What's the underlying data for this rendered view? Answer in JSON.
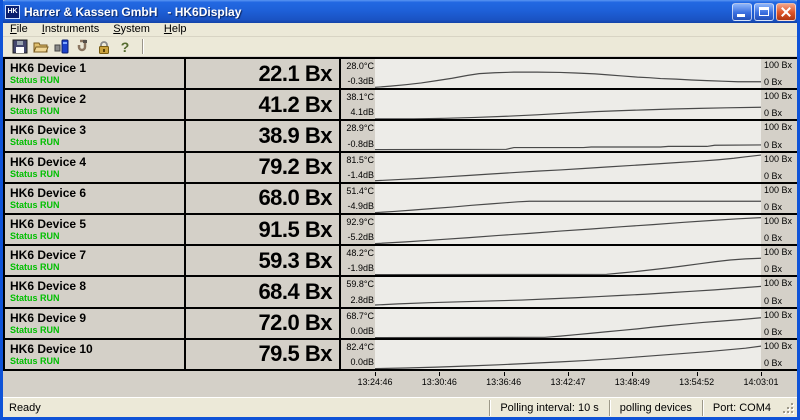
{
  "window": {
    "title": "Harrer & Kassen GmbH   - HK6Display",
    "icon_text": "HK"
  },
  "menu": {
    "items": [
      "File",
      "Instruments",
      "System",
      "Help"
    ]
  },
  "toolbar": {
    "icons": [
      "save-icon",
      "open-folder-icon",
      "instrument-icon",
      "probe-icon",
      "lock-icon",
      "help-icon"
    ]
  },
  "chart_axis": {
    "top": "100 Bx",
    "bottom": "0 Bx"
  },
  "devices": [
    {
      "name": "HK6 Device 1",
      "status": "Status RUN",
      "value": "22.1 Bx",
      "temp": "28.0°C",
      "db": "-0.3dB"
    },
    {
      "name": "HK6 Device 2",
      "status": "Status RUN",
      "value": "41.2 Bx",
      "temp": "38.1°C",
      "db": "4.1dB"
    },
    {
      "name": "HK6 Device 3",
      "status": "Status RUN",
      "value": "38.9 Bx",
      "temp": "28.9°C",
      "db": "-0.8dB"
    },
    {
      "name": "HK6 Device 4",
      "status": "Status RUN",
      "value": "79.2 Bx",
      "temp": "81.5°C",
      "db": "-1.4dB"
    },
    {
      "name": "HK6 Device 6",
      "status": "Status RUN",
      "value": "68.0 Bx",
      "temp": "51.4°C",
      "db": "-4.9dB"
    },
    {
      "name": "HK6 Device 5",
      "status": "Status RUN",
      "value": "91.5 Bx",
      "temp": "92.9°C",
      "db": "-5.2dB"
    },
    {
      "name": "HK6 Device 7",
      "status": "Status RUN",
      "value": "59.3 Bx",
      "temp": "48.2°C",
      "db": "-1.9dB"
    },
    {
      "name": "HK6 Device 8",
      "status": "Status RUN",
      "value": "68.4 Bx",
      "temp": "59.8°C",
      "db": "2.8dB"
    },
    {
      "name": "HK6 Device 9",
      "status": "Status RUN",
      "value": "72.0 Bx",
      "temp": "68.7°C",
      "db": "0.0dB"
    },
    {
      "name": "HK6 Device 10",
      "status": "Status RUN",
      "value": "79.5 Bx",
      "temp": "82.4°C",
      "db": "0.0dB"
    }
  ],
  "chart_data": {
    "type": "line",
    "ylabel": "Bx",
    "ylim": [
      0,
      100
    ],
    "x_range_note": "x is percent of trend window width",
    "x_time_labels": [
      "13:24:46",
      "13:30:46",
      "13:36:46",
      "13:42:47",
      "13:48:49",
      "13:54:52",
      "14:03:01"
    ],
    "series": [
      {
        "name": "HK6 Device 1",
        "current_bx": 22.1,
        "points": [
          [
            0,
            3
          ],
          [
            4,
            7
          ],
          [
            8,
            12
          ],
          [
            12,
            18
          ],
          [
            16,
            26
          ],
          [
            20,
            34
          ],
          [
            24,
            44
          ],
          [
            27,
            50
          ],
          [
            31,
            53
          ],
          [
            36,
            55
          ],
          [
            42,
            55
          ],
          [
            48,
            54
          ],
          [
            52,
            52
          ],
          [
            57,
            49
          ],
          [
            60,
            46
          ],
          [
            64,
            42
          ],
          [
            68,
            38
          ],
          [
            71,
            36
          ],
          [
            74,
            33
          ],
          [
            78,
            31
          ],
          [
            82,
            28
          ],
          [
            86,
            26
          ],
          [
            90,
            24
          ],
          [
            94,
            22
          ],
          [
            100,
            22
          ]
        ]
      },
      {
        "name": "HK6 Device 2",
        "current_bx": 41.2,
        "points": [
          [
            0,
            1
          ],
          [
            10,
            1
          ],
          [
            18,
            3
          ],
          [
            26,
            6
          ],
          [
            34,
            10
          ],
          [
            42,
            15
          ],
          [
            50,
            21
          ],
          [
            57,
            26
          ],
          [
            63,
            29
          ],
          [
            70,
            32
          ],
          [
            77,
            35
          ],
          [
            84,
            37
          ],
          [
            91,
            39
          ],
          [
            100,
            41
          ]
        ]
      },
      {
        "name": "HK6 Device 3",
        "current_bx": 38.9,
        "points": [
          [
            0,
            2
          ],
          [
            34,
            3
          ],
          [
            36,
            9
          ],
          [
            54,
            9
          ],
          [
            56,
            11
          ],
          [
            74,
            11
          ],
          [
            76,
            13
          ],
          [
            86,
            13
          ],
          [
            88,
            17
          ],
          [
            100,
            18
          ]
        ]
      },
      {
        "name": "HK6 Device 4",
        "current_bx": 79.2,
        "points": [
          [
            0,
            5
          ],
          [
            6,
            9
          ],
          [
            12,
            13
          ],
          [
            18,
            18
          ],
          [
            24,
            23
          ],
          [
            30,
            28
          ],
          [
            36,
            33
          ],
          [
            42,
            38
          ],
          [
            48,
            42
          ],
          [
            54,
            47
          ],
          [
            60,
            52
          ],
          [
            66,
            57
          ],
          [
            72,
            62
          ],
          [
            78,
            67
          ],
          [
            84,
            72
          ],
          [
            89,
            77
          ],
          [
            93,
            82
          ],
          [
            96,
            87
          ],
          [
            100,
            93
          ]
        ]
      },
      {
        "name": "HK6 Device 6",
        "current_bx": 68.0,
        "points": [
          [
            0,
            2
          ],
          [
            5,
            6
          ],
          [
            10,
            11
          ],
          [
            15,
            16
          ],
          [
            20,
            21
          ],
          [
            25,
            27
          ],
          [
            30,
            32
          ],
          [
            34,
            36
          ],
          [
            37,
            39
          ],
          [
            40,
            41
          ],
          [
            100,
            41
          ]
        ]
      },
      {
        "name": "HK6 Device 5",
        "current_bx": 91.5,
        "points": [
          [
            0,
            2
          ],
          [
            8,
            8
          ],
          [
            16,
            15
          ],
          [
            24,
            22
          ],
          [
            32,
            30
          ],
          [
            40,
            37
          ],
          [
            48,
            45
          ],
          [
            56,
            52
          ],
          [
            64,
            60
          ],
          [
            72,
            67
          ],
          [
            80,
            75
          ],
          [
            88,
            82
          ],
          [
            94,
            87
          ],
          [
            100,
            91
          ]
        ]
      },
      {
        "name": "HK6 Device 7",
        "current_bx": 59.3,
        "points": [
          [
            0,
            2
          ],
          [
            60,
            3
          ],
          [
            64,
            8
          ],
          [
            68,
            13
          ],
          [
            72,
            19
          ],
          [
            76,
            25
          ],
          [
            80,
            32
          ],
          [
            84,
            39
          ],
          [
            88,
            46
          ],
          [
            92,
            52
          ],
          [
            96,
            56
          ],
          [
            100,
            58
          ]
        ]
      },
      {
        "name": "HK6 Device 8",
        "current_bx": 68.4,
        "points": [
          [
            0,
            4
          ],
          [
            6,
            8
          ],
          [
            14,
            12
          ],
          [
            22,
            15
          ],
          [
            30,
            18
          ],
          [
            38,
            21
          ],
          [
            45,
            25
          ],
          [
            52,
            29
          ],
          [
            58,
            33
          ],
          [
            64,
            37
          ],
          [
            70,
            41
          ],
          [
            76,
            46
          ],
          [
            82,
            51
          ],
          [
            88,
            56
          ],
          [
            93,
            61
          ],
          [
            97,
            65
          ],
          [
            100,
            68
          ]
        ]
      },
      {
        "name": "HK6 Device 9",
        "current_bx": 72.0,
        "points": [
          [
            0,
            2
          ],
          [
            44,
            3
          ],
          [
            48,
            7
          ],
          [
            52,
            12
          ],
          [
            56,
            17
          ],
          [
            60,
            22
          ],
          [
            64,
            27
          ],
          [
            68,
            32
          ],
          [
            72,
            38
          ],
          [
            76,
            43
          ],
          [
            80,
            48
          ],
          [
            85,
            54
          ],
          [
            90,
            59
          ],
          [
            95,
            64
          ],
          [
            100,
            70
          ]
        ]
      },
      {
        "name": "HK6 Device 10",
        "current_bx": 79.5,
        "points": [
          [
            0,
            2
          ],
          [
            8,
            4
          ],
          [
            16,
            7
          ],
          [
            24,
            11
          ],
          [
            32,
            15
          ],
          [
            40,
            20
          ],
          [
            48,
            25
          ],
          [
            55,
            30
          ],
          [
            62,
            36
          ],
          [
            68,
            42
          ],
          [
            74,
            48
          ],
          [
            80,
            54
          ],
          [
            86,
            60
          ],
          [
            91,
            66
          ],
          [
            96,
            72
          ],
          [
            100,
            79
          ]
        ]
      }
    ]
  },
  "status_bar": {
    "ready": "Ready",
    "sections": [
      "Polling interval: 10 s",
      "polling devices",
      "Port: COM4"
    ]
  },
  "colors": {
    "titlebar_blue": "#1e60d8",
    "frame_blue": "#0f53d7",
    "panel_gray": "#d4d0c8",
    "plot_bg": "#edece8",
    "trend_line": "#4a4a4a",
    "status_green": "#00bf00",
    "close_red": "#e0572b"
  }
}
